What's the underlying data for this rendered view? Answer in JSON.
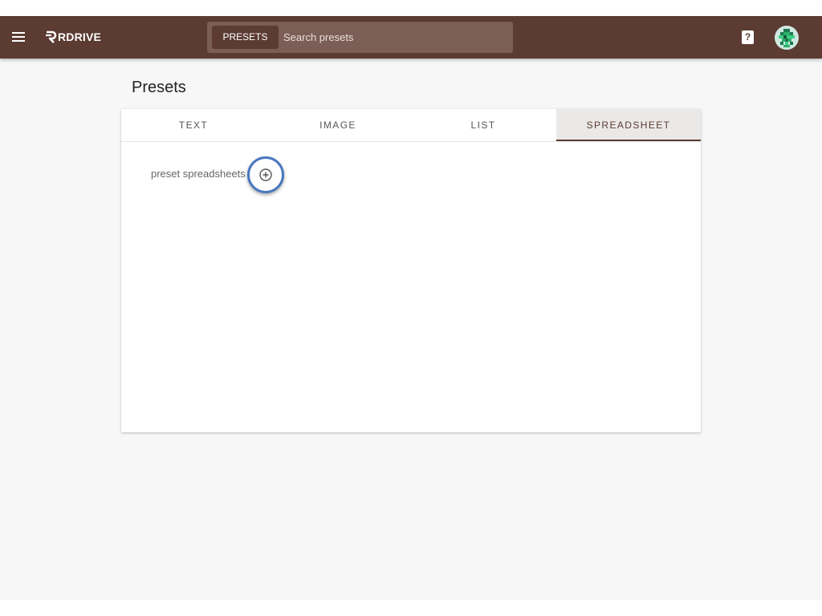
{
  "header": {
    "brand": "RDRIVE",
    "search": {
      "chip_label": "PRESETS",
      "placeholder": "Search presets"
    },
    "help_label": "?",
    "avatar_icon": "pixel-avatar-icon"
  },
  "page": {
    "title": "Presets"
  },
  "tabs": [
    {
      "label": "TEXT",
      "active": false
    },
    {
      "label": "IMAGE",
      "active": false
    },
    {
      "label": "LIST",
      "active": false
    },
    {
      "label": "SPREADSHEET",
      "active": true
    }
  ],
  "section": {
    "label": "preset spreadsheets",
    "add_icon": "plus-circle-icon"
  },
  "colors": {
    "topbar": "#5b3b32",
    "search_bg": "#7b5e55",
    "focus_ring": "#4a78c0",
    "page_bg": "#f7f7f7"
  }
}
